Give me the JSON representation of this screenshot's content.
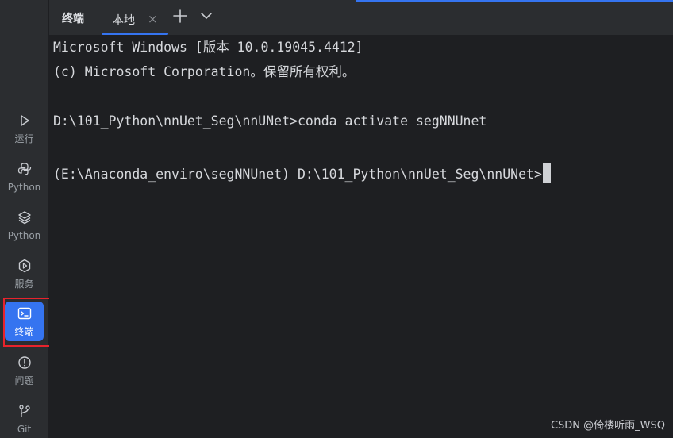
{
  "tabbar": {
    "title": "终端",
    "tab_label": "本地",
    "close_glyph": "×",
    "add_icon": "plus-icon",
    "dropdown_icon": "chevron-down-icon"
  },
  "sidebar": {
    "items": [
      {
        "label": "运行",
        "icon": "run-icon"
      },
      {
        "label": "Python",
        "icon": "python-icon"
      },
      {
        "label": "Python",
        "icon": "layers-icon"
      },
      {
        "label": "服务",
        "icon": "services-icon"
      },
      {
        "label": "终端",
        "icon": "terminal-icon",
        "active": true
      },
      {
        "label": "问题",
        "icon": "problems-icon"
      },
      {
        "label": "Git",
        "icon": "git-icon"
      }
    ]
  },
  "terminal": {
    "lines": [
      "Microsoft Windows [版本 10.0.19045.4412]",
      "(c) Microsoft Corporation。保留所有权利。",
      "",
      "D:\\101_Python\\nnUet_Seg\\nnUNet>conda activate segNNUnet",
      "",
      "(E:\\Anaconda_enviro\\segNNUnet) D:\\101_Python\\nnUet_Seg\\nnUNet>"
    ]
  },
  "watermark": "CSDN @倚楼听雨_WSQ",
  "colors": {
    "accent": "#3574f0",
    "highlight": "#e8232c",
    "background": "#1e1f22",
    "panel": "#2b2d30"
  }
}
